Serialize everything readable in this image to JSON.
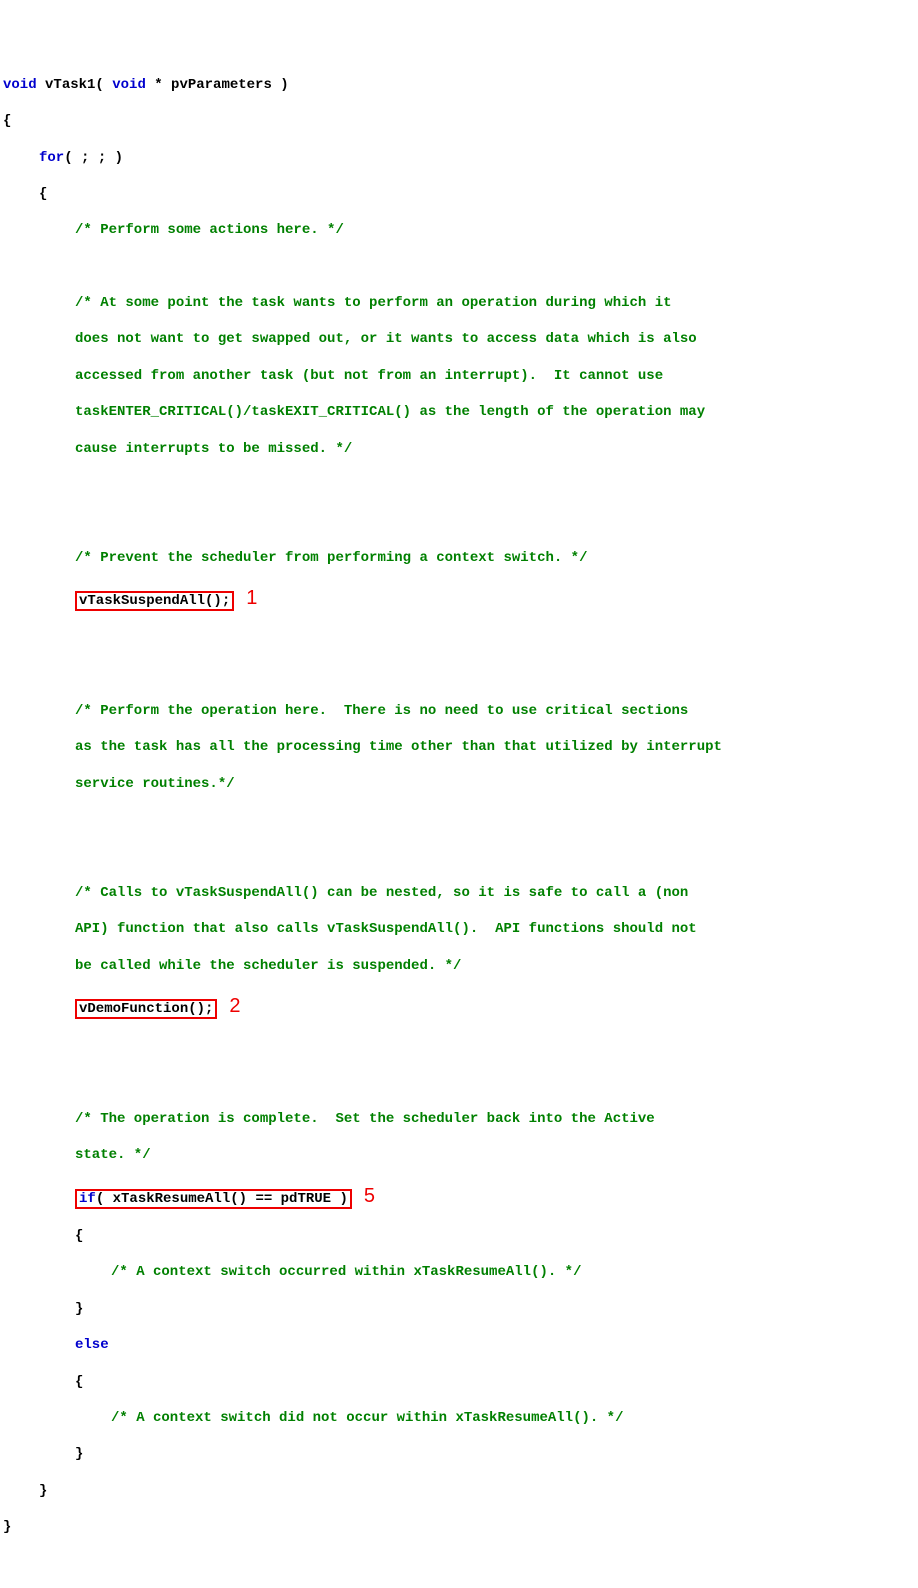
{
  "code": {
    "decl_kw": "void",
    "decl_name": " vTask1( ",
    "decl_kw2": "void",
    "decl_rest": " * pvParameters )",
    "obrace": "{",
    "for_kw": "for",
    "for_rest": "( ; ; )",
    "c_perform": "/* Perform some actions here. */",
    "c_long1": "/* At some point the task wants to perform an operation during which it",
    "c_long2": "does not want to get swapped out, or it wants to access data which is also",
    "c_long3": "accessed from another task (but not from an interrupt).  It cannot use",
    "c_long4": "taskENTER_CRITICAL()/taskEXIT_CRITICAL() as the length of the operation may",
    "c_long5": "cause interrupts to be missed. */",
    "c_prevent": "/* Prevent the scheduler from performing a context switch. */",
    "box1": "vTaskSuspendAll();",
    "annot1": "1",
    "c_op1": "/* Perform the operation here.  There is no need to use critical sections",
    "c_op2": "as the task has all the processing time other than that utilized by interrupt",
    "c_op3": "service routines.*/",
    "c_nest1": "/* Calls to vTaskSuspendAll() can be nested, so it is safe to call a (non",
    "c_nest2": "API) function that also calls vTaskSuspendAll().  API functions should not",
    "c_nest3": "be called while the scheduler is suspended. */",
    "box2": "vDemoFunction();",
    "annot2": "2",
    "c_done1": "/* The operation is complete.  Set the scheduler back into the Active",
    "c_done2": "state. */",
    "box3_if": "if",
    "box3_rest": "( xTaskResumeAll() == pdTRUE )",
    "annot3": "5",
    "c_ctx_yes": "/* A context switch occurred within xTaskResumeAll(). */",
    "else_kw": "else",
    "c_ctx_no": "/* A context switch did not occur within xTaskResumeAll(). */",
    "cbrace": "}"
  }
}
